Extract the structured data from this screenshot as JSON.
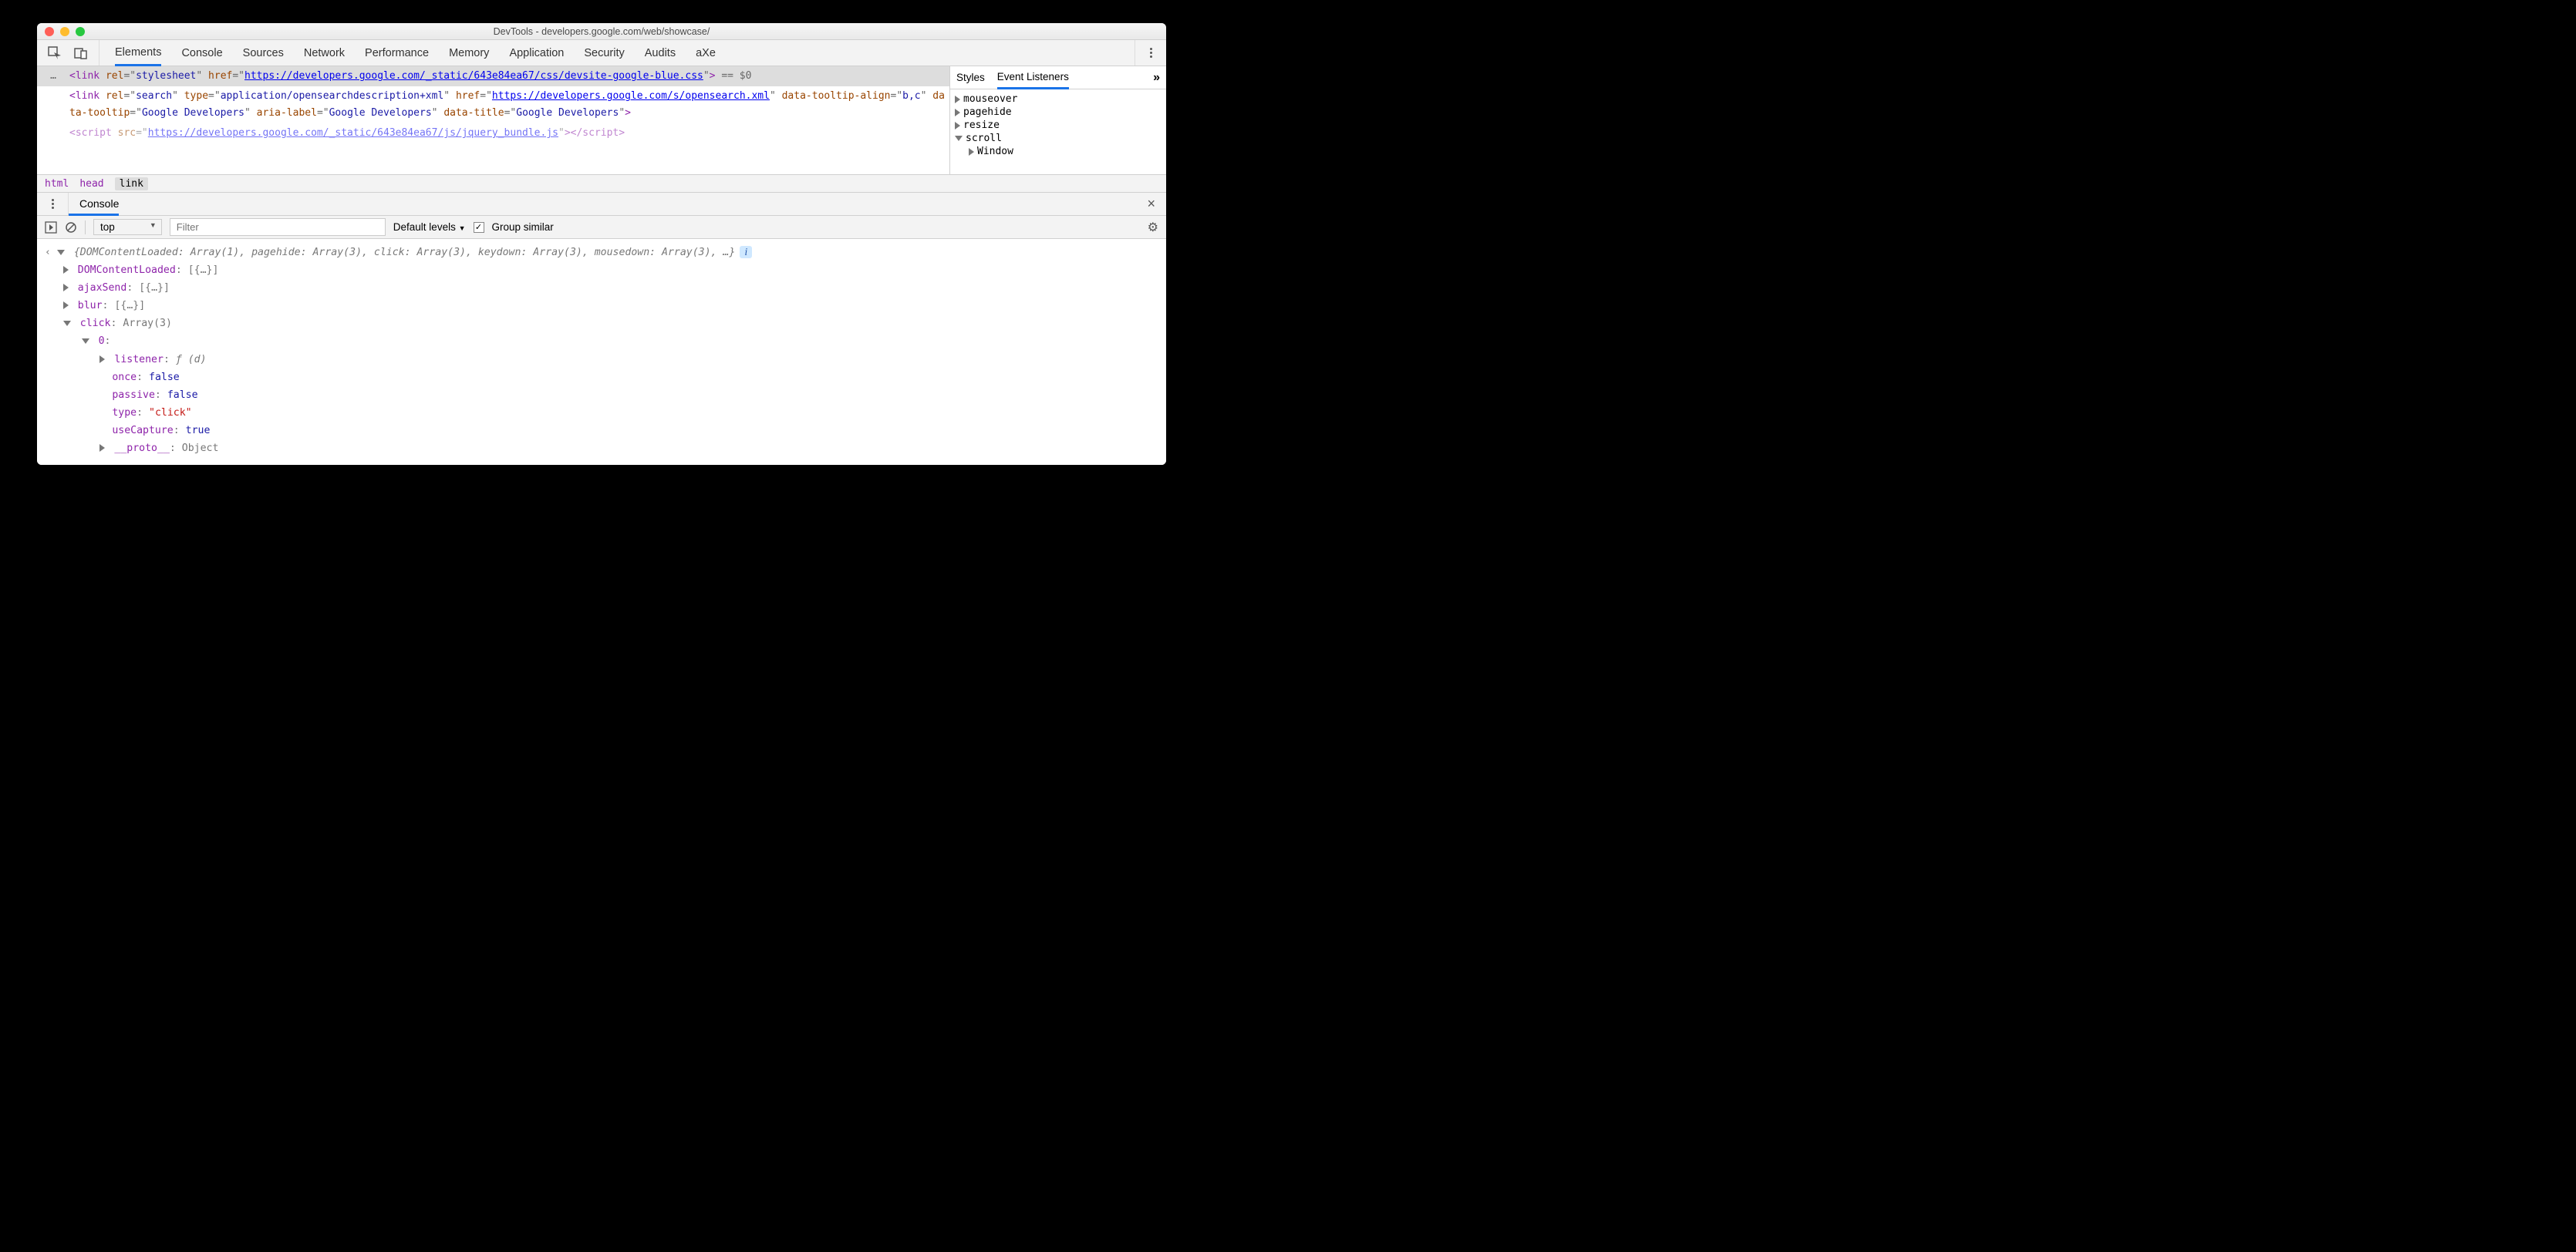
{
  "window": {
    "title": "DevTools - developers.google.com/web/showcase/"
  },
  "tabs": {
    "items": [
      "Elements",
      "Console",
      "Sources",
      "Network",
      "Performance",
      "Memory",
      "Application",
      "Security",
      "Audits",
      "aXe"
    ],
    "active": "Elements"
  },
  "dom": {
    "ellipsis": "…",
    "selected_line_html": "<link rel=\"stylesheet\" href=\"https://developers.google.com/_static/643e84ea67/css/devsite-google-blue.css\"> == $0",
    "selected_parts": {
      "tag_open": "<link ",
      "rel_attr": "rel",
      "rel_val": "stylesheet",
      "href_attr": "href",
      "href_url": "https://developers.google.com/_static/643e84ea67/css/devsite-google-blue.css",
      "close": ">",
      "sel": " == $0"
    },
    "line2": {
      "tag_open": "<link ",
      "rel_attr": "rel",
      "rel_val": "search",
      "type_attr": "type",
      "type_val": "application/opensearchdescription+xml",
      "href_attr": "href",
      "href_url": "https://developers.google.com/s/opensearch.xml",
      "dta_attr": "data-tooltip-align",
      "dta_val": "b,c",
      "dt_attr": "data-tooltip",
      "dt_val": "Google Developers",
      "al_attr": "aria-label",
      "al_val": "Google Developers",
      "dtt_attr": "data-title",
      "dtt_val": "Google Developers",
      "close": ">"
    },
    "line3": {
      "tag_open": "<script ",
      "src_attr": "src",
      "src_url": "https://developers.google.com/_static/643e84ea67/js/jquery_bundle.js",
      "close_tag": "></script>"
    }
  },
  "breadcrumb": {
    "items": [
      "html",
      "head",
      "link"
    ]
  },
  "sidebar": {
    "tabs": [
      "Styles",
      "Event Listeners"
    ],
    "active": "Event Listeners",
    "more": "»",
    "listeners": {
      "items": [
        "mouseover",
        "pagehide",
        "resize",
        "scroll"
      ],
      "expanded": "scroll",
      "child": "Window"
    }
  },
  "drawer": {
    "label": "Console"
  },
  "consoleBar": {
    "context": "top",
    "filter_placeholder": "Filter",
    "levels": "Default levels",
    "group": "Group similar"
  },
  "consoleOut": {
    "summary_prefix": "{DOMContentLoaded: Array(1), pagehide: Array(3), click: Array(3), keydown: Array(3), mousedown: Array(3), …}",
    "rows": [
      {
        "indent": 1,
        "arrow": "right",
        "key": "DOMContentLoaded",
        "sep": ": ",
        "val": "[{…}]"
      },
      {
        "indent": 1,
        "arrow": "right",
        "key": "ajaxSend",
        "sep": ": ",
        "val": "[{…}]"
      },
      {
        "indent": 1,
        "arrow": "right",
        "key": "blur",
        "sep": ": ",
        "val": "[{…}]"
      },
      {
        "indent": 1,
        "arrow": "down",
        "key": "click",
        "sep": ": ",
        "val": "Array(3)"
      },
      {
        "indent": 2,
        "arrow": "down",
        "key": "0",
        "sep": ":",
        "val": ""
      },
      {
        "indent": 3,
        "arrow": "right",
        "key": "listener",
        "sep": ": ",
        "val": "ƒ (d)",
        "ital": true
      },
      {
        "indent": 3,
        "arrow": "",
        "key": "once",
        "sep": ": ",
        "val": "false",
        "vblue": true
      },
      {
        "indent": 3,
        "arrow": "",
        "key": "passive",
        "sep": ": ",
        "val": "false",
        "vblue": true
      },
      {
        "indent": 3,
        "arrow": "",
        "key": "type",
        "sep": ": ",
        "val": "\"click\"",
        "vred": true
      },
      {
        "indent": 3,
        "arrow": "",
        "key": "useCapture",
        "sep": ": ",
        "val": "true",
        "vblue": true
      },
      {
        "indent": 3,
        "arrow": "right",
        "key": "__proto__",
        "sep": ": ",
        "val": "Object"
      }
    ]
  }
}
